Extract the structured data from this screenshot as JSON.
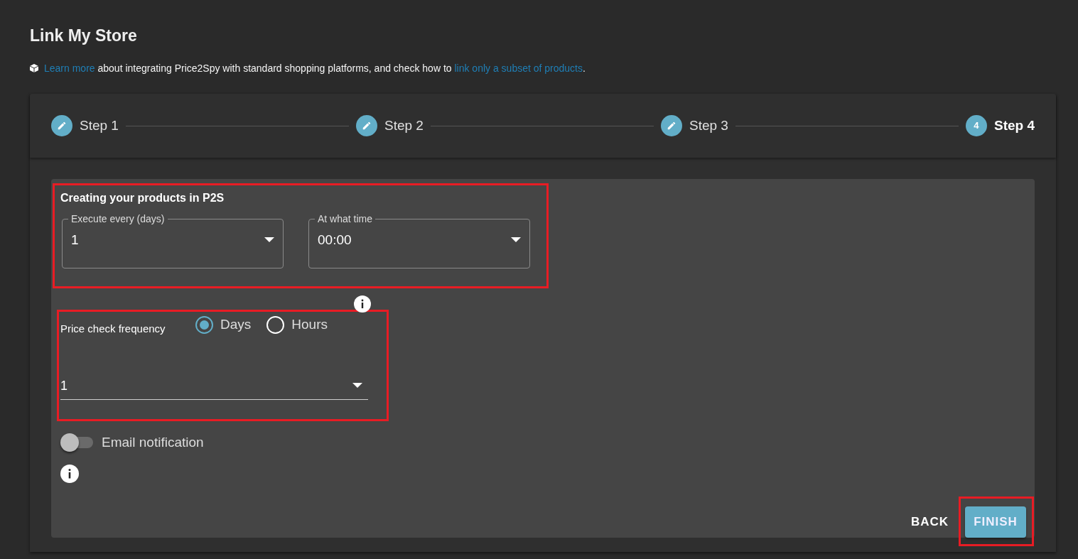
{
  "title": "Link My Store",
  "intro": {
    "link_1": "Learn more",
    "middle": " about integrating Price2Spy with standard shopping platforms, and check how to ",
    "link_2": "link only a subset of products",
    "end": "."
  },
  "steps": [
    {
      "label": "Step 1",
      "kind": "done",
      "selected": false
    },
    {
      "label": "Step 2",
      "kind": "done",
      "selected": false
    },
    {
      "label": "Step 3",
      "kind": "done",
      "selected": false
    },
    {
      "label": "Step 4",
      "kind": "number",
      "number": "4",
      "selected": true
    }
  ],
  "creating": {
    "title": "Creating your products in P2S",
    "fields": [
      {
        "label": "Execute every (days)",
        "value": "1"
      },
      {
        "label": "At what time",
        "value": "00:00"
      }
    ]
  },
  "frequency": {
    "label": "Price check frequency",
    "options": [
      {
        "label": "Days",
        "selected": true
      },
      {
        "label": "Hours",
        "selected": false
      }
    ],
    "value": "1"
  },
  "email_notification": {
    "label": "Email notification",
    "on": false
  },
  "buttons": {
    "back": "BACK",
    "finish": "FINISH"
  }
}
